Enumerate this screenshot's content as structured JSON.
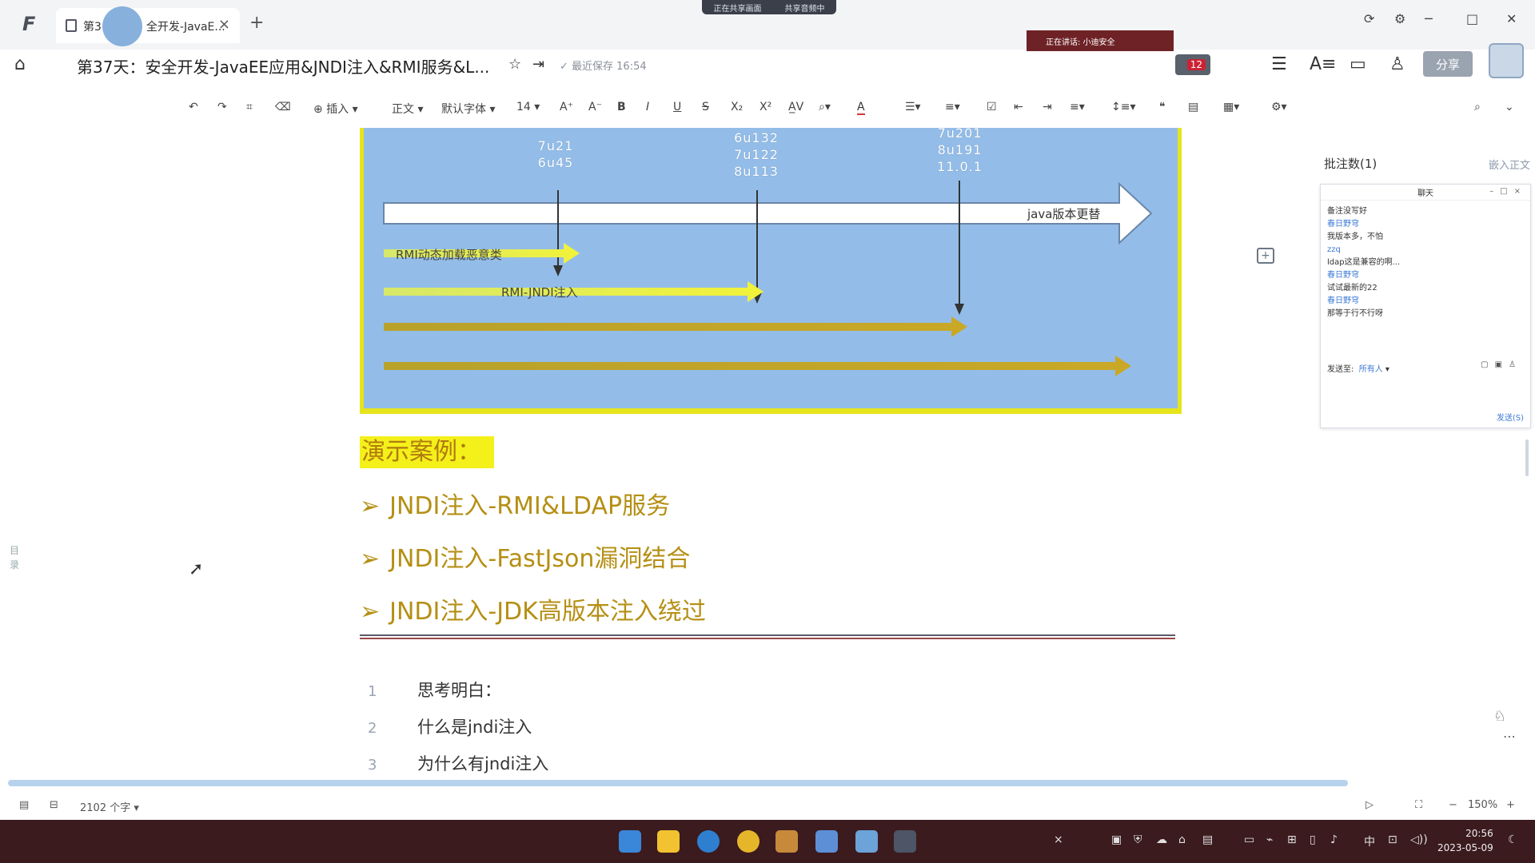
{
  "window": {
    "tab_label_left": "第3",
    "tab_label_right": "全开发-JavaE...",
    "tab_close": "×",
    "new_tab": "+",
    "share_banner": [
      "正在共享画面",
      "共享音频中"
    ],
    "controls": {
      "minimize": "─",
      "maximize": "□",
      "close": "✕"
    }
  },
  "header": {
    "title": "第37天：安全开发-JavaEE应用&JNDI注入&RMI服务&L...",
    "saved_status": "最近保存 16:54",
    "speaking": "正在讲话: 小迪安全",
    "badge_count": "12",
    "share_button": "分享"
  },
  "toolbar": {
    "insert": "插入",
    "paragraph_style": "正文",
    "font": "默认字体",
    "font_size": "14"
  },
  "diagram": {
    "versions": [
      {
        "lines": [
          "7u21",
          "6u45"
        ]
      },
      {
        "lines": [
          "6u132",
          "7u122",
          "8u113"
        ]
      },
      {
        "lines": [
          "7u201",
          "8u191",
          "11.0.1"
        ]
      }
    ],
    "main_arrow_label": "java版本更替",
    "arrow_labels": [
      "RMI动态加载恶意类",
      "RMI-JNDI注入"
    ]
  },
  "content": {
    "demo_heading": "演示案例：",
    "bullets": [
      "JNDI注入-RMI&LDAP服务",
      "JNDI注入-FastJson漏洞结合",
      "JNDI注入-JDK高版本注入绕过"
    ],
    "code_lines": [
      {
        "num": "1",
        "text": "思考明白："
      },
      {
        "num": "2",
        "text": "什么是jndi注入"
      },
      {
        "num": "3",
        "text": "为什么有jndi注入"
      }
    ]
  },
  "comments": {
    "title": "批注数(1)",
    "embed_link": "嵌入正文",
    "chat_title": "聊天",
    "messages": [
      {
        "user": "",
        "text": "备注没写好"
      },
      {
        "user": "春日野穹",
        "text": "我版本多，不怕"
      },
      {
        "user": "zzq",
        "text": "ldap这是兼容的啊..."
      },
      {
        "user": "春日野穹",
        "text": "试试最新的22"
      },
      {
        "user": "春日野穹",
        "text": "那等于行不行呀"
      }
    ],
    "send_to_label": "发送至:",
    "send_to_value": "所有人",
    "send_button": "发送(S)"
  },
  "status": {
    "word_count": "2102 个字",
    "zoom": "150%",
    "zoom_minus": "−",
    "zoom_plus": "+"
  },
  "taskbar": {
    "time": "20:56",
    "date": "2023-05-09",
    "ime": "中"
  },
  "colors": {
    "diagram_bg": "#93bde8",
    "highlight_yellow": "#f4f01a",
    "bullet_text": "#b58f14",
    "taskbar_bg": "#3b1b1e"
  }
}
